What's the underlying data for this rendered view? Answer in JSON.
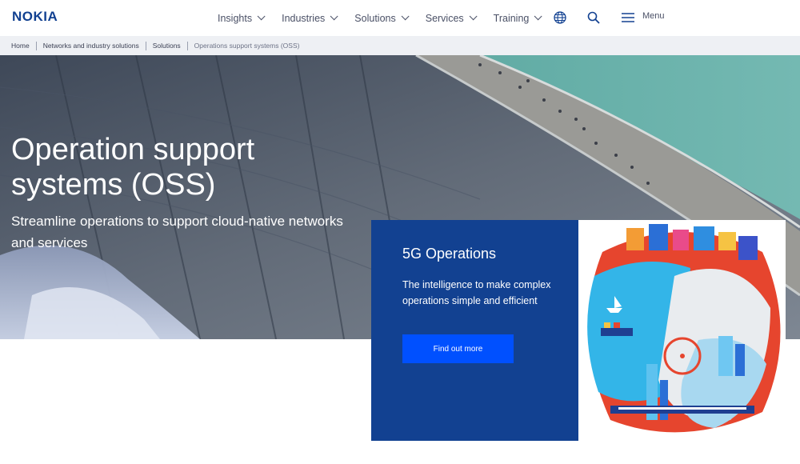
{
  "brand": {
    "logo": "NOKIA",
    "color": "#124191",
    "accent": "#0050ff"
  },
  "nav": {
    "items": [
      {
        "label": "Insights"
      },
      {
        "label": "Industries"
      },
      {
        "label": "Solutions"
      },
      {
        "label": "Services"
      },
      {
        "label": "Training"
      }
    ],
    "icons": [
      "globe-icon",
      "search-icon",
      "hamburger-icon"
    ],
    "menu_label": "Menu"
  },
  "breadcrumb": {
    "items": [
      "Home",
      "Networks and industry solutions",
      "Solutions",
      "Operations support systems (OSS)"
    ]
  },
  "hero": {
    "title": "Operation support systems (OSS)",
    "subtitle": "Streamline operations to support cloud-native networks and services"
  },
  "promo": {
    "title": "5G Operations",
    "text": "The intelligence to make complex operations simple and efficient",
    "button": "Find out more"
  }
}
